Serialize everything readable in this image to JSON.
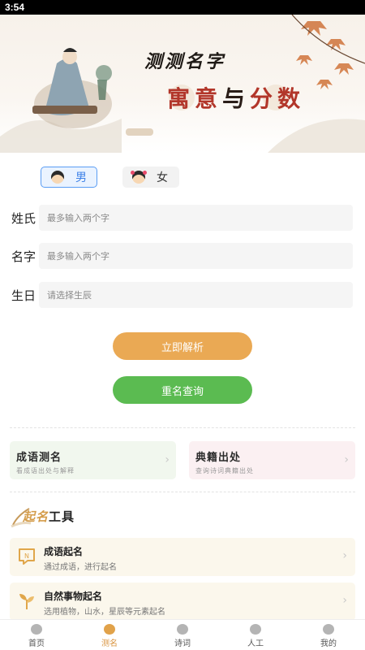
{
  "status_bar": {
    "time": "3:54"
  },
  "banner": {
    "title_line1": "测测名字",
    "title_line2_a": "寓意",
    "title_line2_b": "与",
    "title_line2_c": "分数"
  },
  "gender": {
    "male": "男",
    "female": "女"
  },
  "form": {
    "surname_label": "姓氏",
    "surname_placeholder": "最多输入两个字",
    "name_label": "名字",
    "name_placeholder": "最多输入两个字",
    "birthday_label": "生日",
    "birthday_placeholder": "请选择生辰"
  },
  "buttons": {
    "analyze": "立即解析",
    "rename": "重名查询"
  },
  "cards": [
    {
      "title": "成语测名",
      "subtitle": "看成语出处与解释"
    },
    {
      "title": "典籍出处",
      "subtitle": "查询诗词典籍出处"
    }
  ],
  "tools": {
    "header_a": "起名",
    "header_b": "工具",
    "items": [
      {
        "title": "成语起名",
        "subtitle": "通过成语，进行起名",
        "icon": "idiom-icon"
      },
      {
        "title": "自然事物起名",
        "subtitle": "选用植物，山水，星辰等元素起名",
        "icon": "plant-icon"
      }
    ]
  },
  "tabbar": {
    "items": [
      {
        "label": "首页",
        "icon": "home-icon"
      },
      {
        "label": "测名",
        "icon": "test-name-icon"
      },
      {
        "label": "诗词",
        "icon": "poetry-icon"
      },
      {
        "label": "人工",
        "icon": "manual-icon"
      },
      {
        "label": "我的",
        "icon": "profile-icon"
      }
    ],
    "active_index": 1
  },
  "colors": {
    "accent": "#eaa954",
    "green": "#5bbb51",
    "male_blue": "#3f82e8",
    "active_tab": "#d99440"
  }
}
